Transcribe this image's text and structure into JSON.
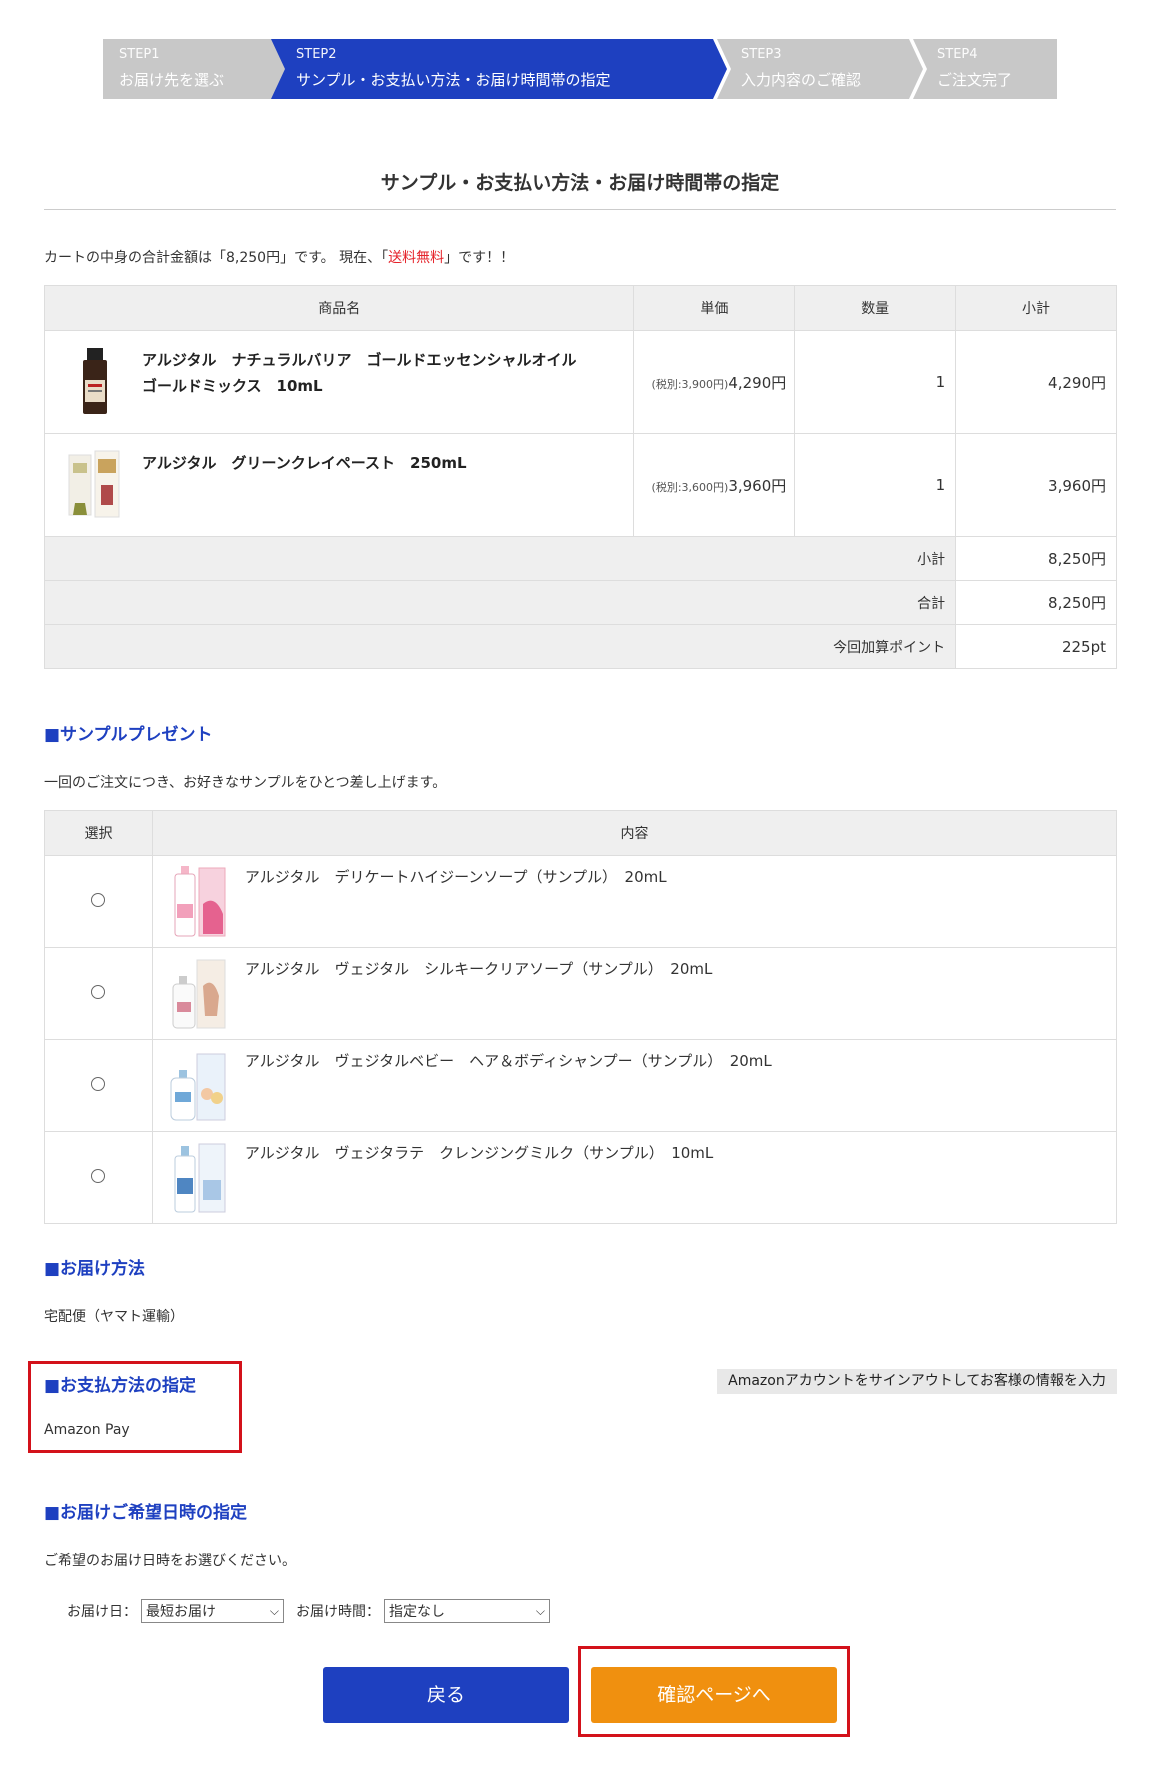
{
  "steps": [
    {
      "num": "STEP1",
      "label": "お届け先を選ぶ"
    },
    {
      "num": "STEP2",
      "label": "サンプル・お支払い方法・お届け時間帯の指定"
    },
    {
      "num": "STEP3",
      "label": "入力内容のご確認"
    },
    {
      "num": "STEP4",
      "label": "ご注文完了"
    }
  ],
  "page_title": "サンプル・お支払い方法・お届け時間帯の指定",
  "cart_message": {
    "prefix": "カートの中身の合計金額は「8,250円」です。 現在、「",
    "highlight": "送料無料",
    "suffix": "」です！！"
  },
  "cart": {
    "headers": [
      "商品名",
      "単価",
      "数量",
      "小計"
    ],
    "items": [
      {
        "name_line1": "アルジタル　ナチュラルバリア　ゴールドエッセンシャルオイル",
        "name_line2": "ゴールドミックス　10mL",
        "tax_note": "(税別:3,900円)",
        "price": "4,290円",
        "qty": "1",
        "subtotal": "4,290円"
      },
      {
        "name_line1": "アルジタル　グリーンクレイペースト　250mL",
        "name_line2": "",
        "tax_note": "(税別:3,600円)",
        "price": "3,960円",
        "qty": "1",
        "subtotal": "3,960円"
      }
    ],
    "summary": [
      {
        "label": "小計",
        "value": "8,250円"
      },
      {
        "label": "合計",
        "value": "8,250円"
      },
      {
        "label": "今回加算ポイント",
        "value": "225pt"
      }
    ]
  },
  "sample_section": {
    "heading": "■サンプルプレゼント",
    "description": "一回のご注文につき、お好きなサンプルをひとつ差し上げます。",
    "headers": [
      "選択",
      "内容"
    ],
    "items": [
      {
        "text": "アルジタル　デリケートハイジーンソープ（サンプル）　20mL"
      },
      {
        "text": "アルジタル　ヴェジタル　シルキークリアソープ（サンプル）　20mL"
      },
      {
        "text": "アルジタル　ヴェジタルベビー　ヘア＆ボディシャンプー（サンプル）　20mL"
      },
      {
        "text": "アルジタル　ヴェジタラテ　クレンジングミルク（サンプル）　10mL"
      }
    ]
  },
  "delivery_method": {
    "heading": "■お届け方法",
    "value": "宅配便（ヤマト運輸）"
  },
  "payment": {
    "heading": "■お支払方法の指定",
    "value": "Amazon Pay",
    "amazon_button": "Amazonアカウントをサインアウトしてお客様の情報を入力"
  },
  "delivery_time": {
    "heading": "■お届けご希望日時の指定",
    "description": "ご希望のお届け日時をお選びください。",
    "date_label": "お届け日：",
    "date_value": "最短お届け",
    "time_label": "お届け時間：",
    "time_value": "指定なし"
  },
  "buttons": {
    "back": "戻る",
    "next": "確認ページへ"
  },
  "colors": {
    "accent": "#1e40c0",
    "next_button": "#f0900f",
    "highlight_red": "#e5232b",
    "annotation_red": "#d3111a"
  }
}
